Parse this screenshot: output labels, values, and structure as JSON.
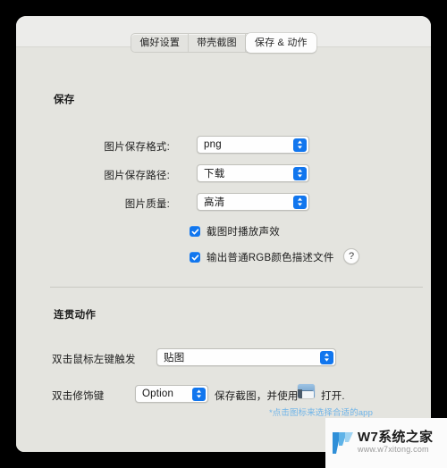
{
  "window": {
    "tabs": [
      {
        "label": "偏好设置",
        "selected": false
      },
      {
        "label": "带壳截图",
        "selected": false
      },
      {
        "label": "保存 & 动作",
        "selected": true
      }
    ]
  },
  "save_section": {
    "title": "保存",
    "rows": [
      {
        "label": "图片保存格式:",
        "value": "png"
      },
      {
        "label": "图片保存路径:",
        "value": "下载"
      },
      {
        "label": "图片质量:",
        "value": "高清"
      }
    ],
    "checkboxes": [
      {
        "label": "截图时播放声效",
        "checked": true
      },
      {
        "label": "输出普通RGB颜色描述文件",
        "checked": true
      }
    ],
    "help_label": "?"
  },
  "actions_section": {
    "title": "连贯动作",
    "double_click_row": {
      "label": "双击鼠标左键触发",
      "value": "贴图"
    },
    "modifier_row": {
      "label": "双击修饰键",
      "value": "Option",
      "text_before_icon": "保存截图，并使用",
      "text_after_icon": "打开.",
      "icon_name": "preview-app-icon"
    },
    "hint": "*点击图标来选择合适的app"
  },
  "watermark": {
    "title": "W7系统之家",
    "url": "www.w7xitong.com"
  },
  "colors": {
    "accent": "#1176ee",
    "titlebar": "#ececea",
    "content": "#e4e4df",
    "hint": "#6fb4e8"
  }
}
